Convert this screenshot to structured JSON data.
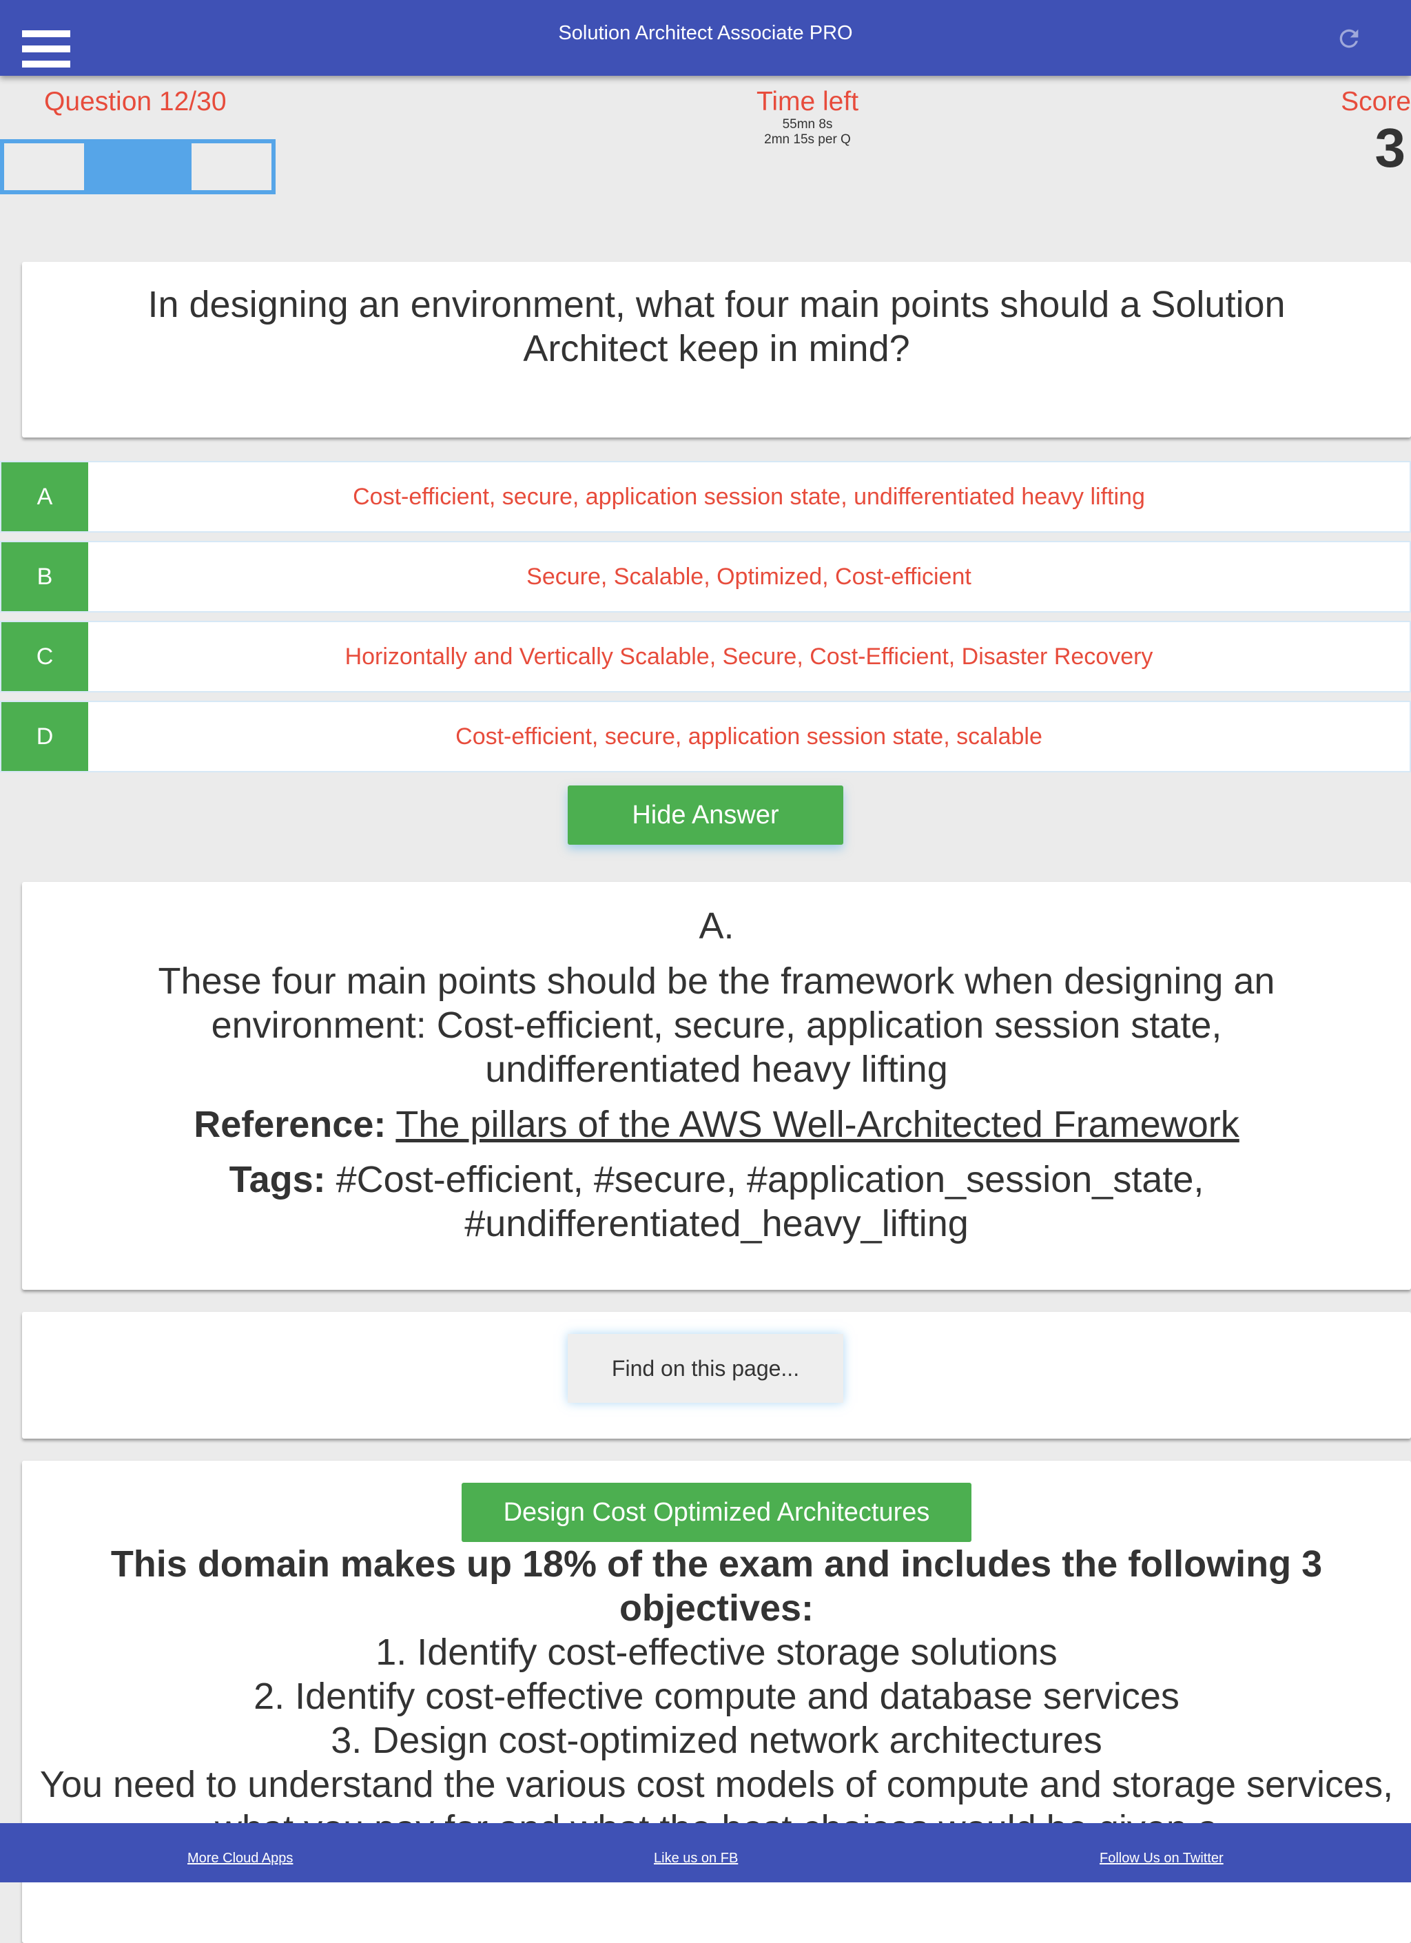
{
  "header": {
    "title": "Solution Architect Associate PRO",
    "menu_icon": "hamburger-menu-icon",
    "refresh_icon": "refresh-icon"
  },
  "status": {
    "question_counter": "Question 12/30",
    "time_label": "Time left",
    "time_remaining": "55mn 8s",
    "time_per_question": "2mn 15s per Q",
    "score_label": "Score",
    "score_value": "3"
  },
  "colors": {
    "primary": "#3f51b5",
    "accent_red": "#e74c3c",
    "green": "#4caf50",
    "nav_blue": "#56a5e8"
  },
  "question": {
    "text": "In designing an environment, what four main points should a Solution Architect keep in mind?"
  },
  "options": [
    {
      "letter": "A",
      "text": "Cost-efficient, secure, application session state, undifferentiated heavy lifting"
    },
    {
      "letter": "B",
      "text": "Secure, Scalable, Optimized, Cost-efficient"
    },
    {
      "letter": "C",
      "text": "Horizontally and Vertically Scalable, Secure, Cost-Efficient, Disaster Recovery"
    },
    {
      "letter": "D",
      "text": "Cost-efficient, secure, application session state, scalable"
    }
  ],
  "hide_answer_label": "Hide Answer",
  "answer": {
    "letter": "A.",
    "explanation": "These four main points should be the framework when designing an environment: Cost-efficient, secure, application session state, undifferentiated heavy lifting",
    "reference_label": "Reference:",
    "reference_link": "The pillars of the AWS Well-Architected Framework",
    "tags_label": "Tags:",
    "tags": "#Cost-efficient, #secure, #application_session_state, #undifferentiated_heavy_lifting"
  },
  "find_label": "Find on this page...",
  "domain": {
    "button_label": "Design Cost Optimized Architectures",
    "heading": "This domain makes up 18% of the exam and includes the following 3 objectives:",
    "objectives": [
      "1. Identify cost-effective storage solutions",
      "2. Identify cost-effective compute and database services",
      "3. Design cost-optimized network architectures"
    ],
    "description": "You need to understand the various cost models of compute and storage services, what you pay for and what the best choices would be given a"
  },
  "footer": {
    "links": [
      "More Cloud Apps",
      "Like us on FB",
      "Follow Us on Twitter"
    ]
  }
}
